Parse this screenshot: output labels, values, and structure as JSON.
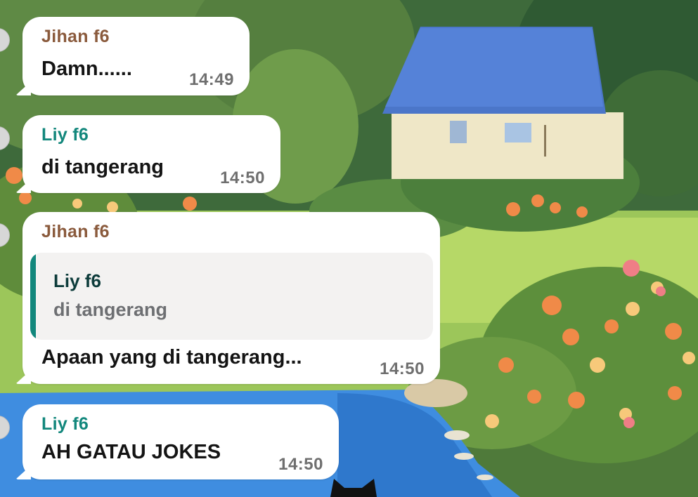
{
  "colors": {
    "sender_jihan": "#8a5a3c",
    "sender_liy": "#12877c",
    "bubble_bg": "#ffffff",
    "quote_bg": "#f3f2f1",
    "quote_accent": "#12877c",
    "timestamp": "#6f6f6f"
  },
  "messages": [
    {
      "sender": "Jihan f6",
      "text": "Damn......",
      "time": "14:49"
    },
    {
      "sender": "Liy f6",
      "text": "di tangerang",
      "time": "14:50"
    },
    {
      "sender": "Jihan f6",
      "reply_to": {
        "sender": "Liy f6",
        "text": "di tangerang"
      },
      "text": "Apaan yang di tangerang...",
      "time": "14:50"
    },
    {
      "sender": "Liy f6",
      "text": "AH GATAU JOKES",
      "time": "14:50"
    }
  ]
}
